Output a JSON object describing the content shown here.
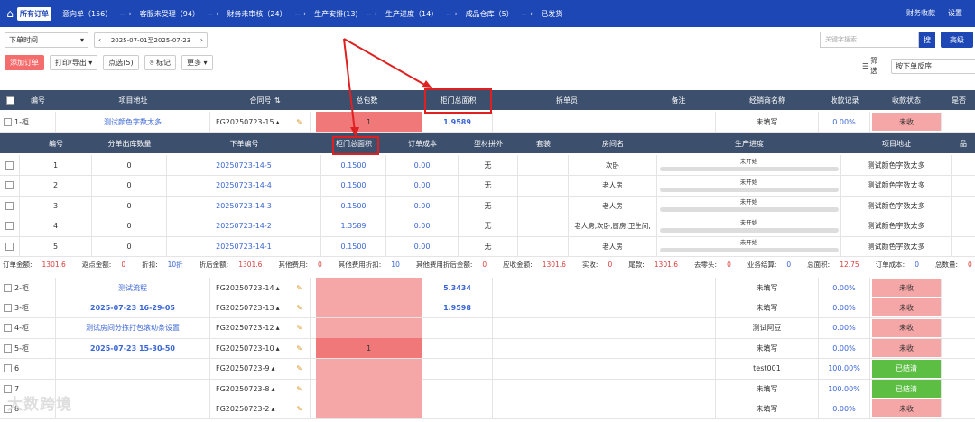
{
  "topbar": {
    "active_tab": "所有订单",
    "flow": [
      "意向单（156）",
      "客服未受理（94）",
      "财务未审核（24）",
      "生产安排(13)",
      "生产进度（14）",
      "成品仓库（5）",
      "已发货"
    ],
    "right": [
      "财务收款",
      "设置"
    ]
  },
  "toolbar": {
    "date_type": "下单时间",
    "date_range": "2025-07-01至2025-07-23",
    "search_placeholder": "关键字搜索",
    "search_btn": "搜",
    "advanced": "高级",
    "add_order": "添加订单",
    "print_export": "打印/导出",
    "pick": "点选(5)",
    "mark": "标记",
    "more": "更多",
    "filter": "筛选",
    "sort": "按下单反序"
  },
  "columns": [
    "编号",
    "项目地址",
    "合同号",
    "总包数",
    "柜门总面积",
    "拆单员",
    "备注",
    "经销商名称",
    "收款记录",
    "收款状态",
    "是否"
  ],
  "main_row": {
    "no": "1-柜",
    "address": "测试颜色字数太多",
    "contract": "FG20250723-15",
    "packages": "1",
    "area": "1.9589",
    "dealer": "未填写",
    "rate": "0.00%",
    "status": "未收"
  },
  "sub_columns": [
    "编号",
    "分单出库数量",
    "下单编号",
    "柜门总面积",
    "订单成本",
    "型材拼外",
    "套装",
    "房间名",
    "生产进度",
    "项目地址",
    "品"
  ],
  "sub_rows": [
    {
      "no": "1",
      "qty": "0",
      "code": "20250723-14-5",
      "area": "0.1500",
      "cost": "0.00",
      "frame": "无",
      "room": "次卧",
      "progress": "未开始",
      "address": "测试颜色字数太多"
    },
    {
      "no": "2",
      "qty": "0",
      "code": "20250723-14-4",
      "area": "0.1500",
      "cost": "0.00",
      "frame": "无",
      "room": "老人房",
      "progress": "未开始",
      "address": "测试颜色字数太多"
    },
    {
      "no": "3",
      "qty": "0",
      "code": "20250723-14-3",
      "area": "0.1500",
      "cost": "0.00",
      "frame": "无",
      "room": "老人房",
      "progress": "未开始",
      "address": "测试颜色字数太多"
    },
    {
      "no": "4",
      "qty": "0",
      "code": "20250723-14-2",
      "area": "1.3589",
      "cost": "0.00",
      "frame": "无",
      "room": "老人房,次卧,厨房,卫生间,",
      "progress": "未开始",
      "address": "测试颜色字数太多"
    },
    {
      "no": "5",
      "qty": "0",
      "code": "20250723-14-1",
      "area": "0.1500",
      "cost": "0.00",
      "frame": "无",
      "room": "老人房",
      "progress": "未开始",
      "address": "测试颜色字数太多"
    }
  ],
  "summary": [
    [
      "订单金额:",
      "1301.6"
    ],
    [
      "返点金额:",
      "0"
    ],
    [
      "折扣:",
      "10折"
    ],
    [
      "折后金额:",
      "1301.6"
    ],
    [
      "其他费用:",
      "0"
    ],
    [
      "其他费用折扣:",
      "10"
    ],
    [
      "其他费用折后金额:",
      "0"
    ],
    [
      "应收金额:",
      "1301.6"
    ],
    [
      "实收:",
      "0"
    ],
    [
      "尾款:",
      "1301.6"
    ],
    [
      "去零头:",
      "0"
    ],
    [
      "业务结算:",
      "0"
    ],
    [
      "总面积:",
      "12.75"
    ],
    [
      "订单成本:",
      "0"
    ],
    [
      "总数量:",
      "0"
    ]
  ],
  "rows": [
    {
      "no": "2-柜",
      "address": "测试流程",
      "contract": "FG20250723-14",
      "packages": "",
      "area": "5.3434",
      "dealer": "未填写",
      "rate": "0.00%",
      "status": "未收"
    },
    {
      "no": "3-柜",
      "address": "2025-07-23 16-29-05",
      "contract": "FG20250723-13",
      "packages": "",
      "area": "1.9598",
      "dealer": "未填写",
      "rate": "0.00%",
      "status": "未收"
    },
    {
      "no": "4-柜",
      "address": "测试房间分拣打包滚动条设置",
      "contract": "FG20250723-12",
      "packages": "",
      "area": "",
      "dealer": "测试阿豆",
      "rate": "0.00%",
      "status": "未收"
    },
    {
      "no": "5-柜",
      "address": "2025-07-23 15-30-50",
      "contract": "FG20250723-10",
      "packages": "1",
      "area": "",
      "dealer": "未填写",
      "rate": "0.00%",
      "status": "未收"
    },
    {
      "no": "6",
      "address": "",
      "contract": "FG20250723-9",
      "packages": "",
      "area": "",
      "dealer": "test001",
      "rate": "100.00%",
      "status": "已结清"
    },
    {
      "no": "7",
      "address": "",
      "contract": "FG20250723-8",
      "packages": "",
      "area": "",
      "dealer": "未填写",
      "rate": "100.00%",
      "status": "已结清"
    },
    {
      "no": "8",
      "address": "",
      "contract": "FG20250723-2",
      "packages": "",
      "area": "",
      "dealer": "未填写",
      "rate": "0.00%",
      "status": "未收"
    }
  ],
  "watermark": "大数跨境"
}
